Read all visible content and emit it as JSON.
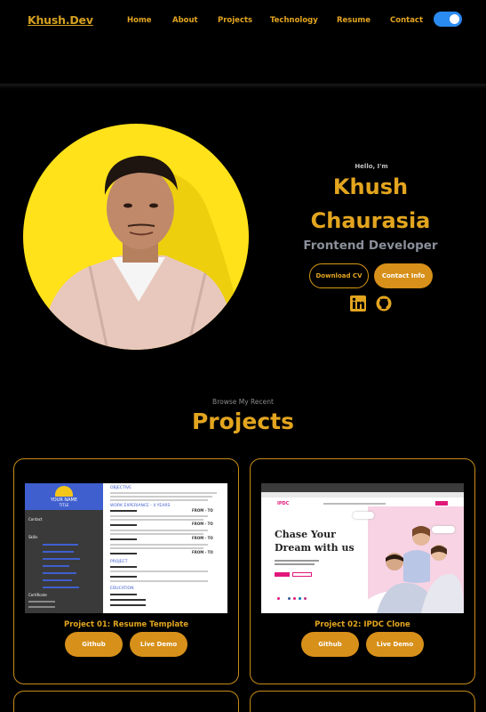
{
  "nav": {
    "logo": "Khush.Dev",
    "items": [
      "Home",
      "About",
      "Projects",
      "Technology",
      "Resume",
      "Contact"
    ]
  },
  "hero": {
    "greeting": "Hello, I'm",
    "first_name": "Khush",
    "last_name": "Chaurasia",
    "role": "Frontend Developer",
    "download_cv": "Download CV",
    "contact_info": "Contact Info"
  },
  "projects": {
    "subtitle": "Browse My Recent",
    "title": "Projects",
    "cards": [
      {
        "title": "Project 01: Resume Template",
        "github": "Github",
        "demo": "Live Demo"
      },
      {
        "title": "Project 02: IPDC Clone",
        "github": "Github",
        "demo": "Live Demo"
      }
    ]
  },
  "thumb_resume": {
    "name": "YOUR NAME",
    "role": "TITLE",
    "sections": [
      "OBJECTIVE",
      "WORK EXPERIANCE - 4 YEARS",
      "PROJECT",
      "EDUCATION"
    ],
    "side": [
      "Contact",
      "Skills",
      "Certificate"
    ],
    "date": "FROM - TO"
  },
  "thumb_ipdc": {
    "logo": "IPDC",
    "headline_1": "Chase Your",
    "headline_2": "Dream with us"
  },
  "colors": {
    "accent": "#e3a51f",
    "toggle": "#2a8bf0",
    "avatar_bg": "#ffe21a"
  }
}
